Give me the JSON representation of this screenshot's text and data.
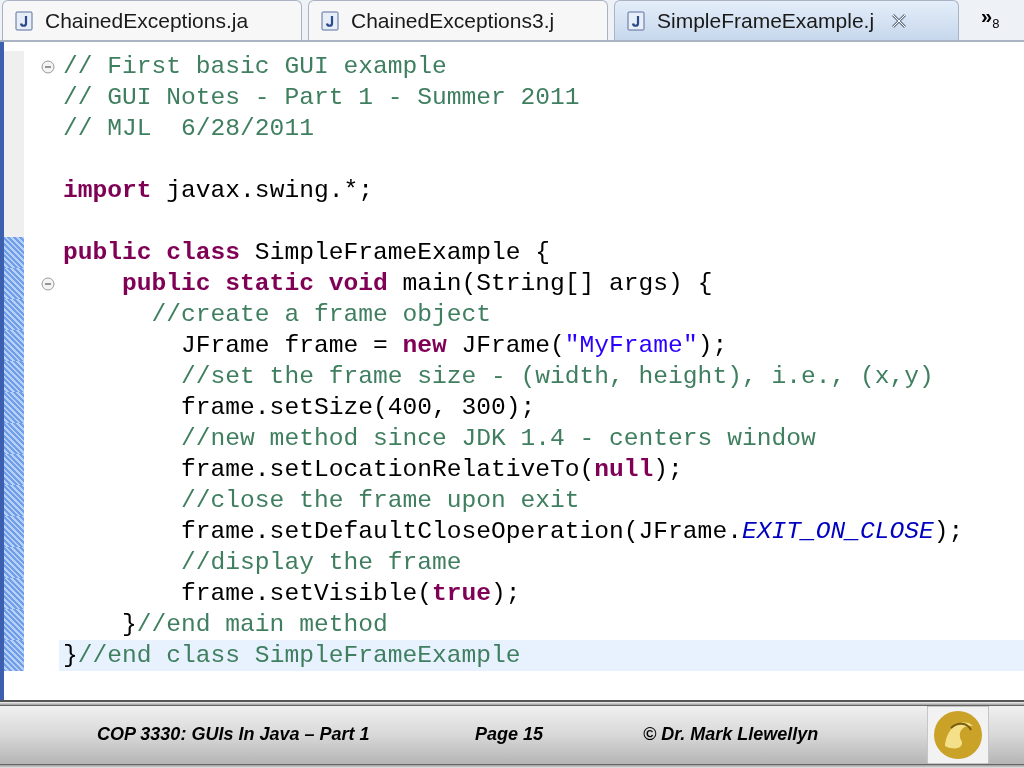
{
  "tabs": [
    {
      "label": "ChainedExceptions.ja",
      "selected": false,
      "closable": false
    },
    {
      "label": "ChainedExceptions3.j",
      "selected": false,
      "closable": false
    },
    {
      "label": "SimpleFrameExample.j",
      "selected": true,
      "closable": true
    }
  ],
  "overflow": {
    "icon": "»",
    "count": "8"
  },
  "editor": {
    "lines": [
      {
        "kind": "code",
        "fold": true,
        "range": false,
        "current": false,
        "tokens": [
          {
            "kind": "comment",
            "text": "// First basic GUI example"
          }
        ]
      },
      {
        "kind": "code",
        "fold": false,
        "range": false,
        "current": false,
        "tokens": [
          {
            "kind": "comment",
            "text": "// GUI Notes - Part 1 - Summer 2011"
          }
        ]
      },
      {
        "kind": "code",
        "fold": false,
        "range": false,
        "current": false,
        "tokens": [
          {
            "kind": "comment",
            "text": "// MJL  6/28/2011"
          }
        ]
      },
      {
        "kind": "blank",
        "fold": false,
        "range": false,
        "current": false
      },
      {
        "kind": "code",
        "fold": false,
        "range": false,
        "current": false,
        "tokens": [
          {
            "kind": "keyword",
            "text": "import"
          },
          {
            "kind": "plain",
            "text": " javax.swing.*;"
          }
        ]
      },
      {
        "kind": "blank",
        "fold": false,
        "range": false,
        "current": false
      },
      {
        "kind": "code",
        "fold": false,
        "range": true,
        "current": false,
        "tokens": [
          {
            "kind": "keyword",
            "text": "public class"
          },
          {
            "kind": "plain",
            "text": " SimpleFrameExample {"
          }
        ]
      },
      {
        "kind": "code",
        "fold": true,
        "range": true,
        "current": false,
        "tokens": [
          {
            "kind": "keyword",
            "text": "    public static void"
          },
          {
            "kind": "plain",
            "text": " main(String[] args) {"
          }
        ]
      },
      {
        "kind": "code",
        "fold": false,
        "range": true,
        "current": false,
        "tokens": [
          {
            "kind": "comment",
            "text": "      //create a frame object"
          }
        ]
      },
      {
        "kind": "code",
        "fold": false,
        "range": true,
        "current": false,
        "tokens": [
          {
            "kind": "plain",
            "text": "        JFrame frame = "
          },
          {
            "kind": "keyword",
            "text": "new"
          },
          {
            "kind": "plain",
            "text": " JFrame("
          },
          {
            "kind": "string",
            "text": "\"MyFrame\""
          },
          {
            "kind": "plain",
            "text": ");"
          }
        ]
      },
      {
        "kind": "code",
        "fold": false,
        "range": true,
        "current": false,
        "tokens": [
          {
            "kind": "comment",
            "text": "        //set the frame size - (width, height), i.e., (x,y)"
          }
        ]
      },
      {
        "kind": "code",
        "fold": false,
        "range": true,
        "current": false,
        "tokens": [
          {
            "kind": "plain",
            "text": "        frame.setSize(400, 300);"
          }
        ]
      },
      {
        "kind": "code",
        "fold": false,
        "range": true,
        "current": false,
        "tokens": [
          {
            "kind": "comment",
            "text": "        //new method since JDK 1.4 - centers window"
          }
        ]
      },
      {
        "kind": "code",
        "fold": false,
        "range": true,
        "current": false,
        "tokens": [
          {
            "kind": "plain",
            "text": "        frame.setLocationRelativeTo("
          },
          {
            "kind": "keyword",
            "text": "null"
          },
          {
            "kind": "plain",
            "text": ");"
          }
        ]
      },
      {
        "kind": "code",
        "fold": false,
        "range": true,
        "current": false,
        "tokens": [
          {
            "kind": "comment",
            "text": "        //close the frame upon exit"
          }
        ]
      },
      {
        "kind": "code",
        "fold": false,
        "range": true,
        "current": false,
        "tokens": [
          {
            "kind": "plain",
            "text": "        frame.setDefaultCloseOperation(JFrame."
          },
          {
            "kind": "constant",
            "text": "EXIT_ON_CLOSE"
          },
          {
            "kind": "plain",
            "text": ");"
          }
        ]
      },
      {
        "kind": "code",
        "fold": false,
        "range": true,
        "current": false,
        "tokens": [
          {
            "kind": "comment",
            "text": "        //display the frame"
          }
        ]
      },
      {
        "kind": "code",
        "fold": false,
        "range": true,
        "current": false,
        "tokens": [
          {
            "kind": "plain",
            "text": "        frame.setVisible("
          },
          {
            "kind": "keyword",
            "text": "true"
          },
          {
            "kind": "plain",
            "text": ");"
          }
        ]
      },
      {
        "kind": "code",
        "fold": false,
        "range": true,
        "current": false,
        "tokens": [
          {
            "kind": "plain",
            "text": "    }"
          },
          {
            "kind": "comment",
            "text": "//end main method"
          }
        ]
      },
      {
        "kind": "code",
        "fold": false,
        "range": true,
        "current": true,
        "tokens": [
          {
            "kind": "plain",
            "text": "}"
          },
          {
            "kind": "comment",
            "text": "//end class SimpleFrameExample"
          }
        ]
      }
    ]
  },
  "footer": {
    "course": "COP 3330:  GUIs In Java – Part 1",
    "page": "Page 15",
    "author": "© Dr. Mark Llewellyn"
  }
}
